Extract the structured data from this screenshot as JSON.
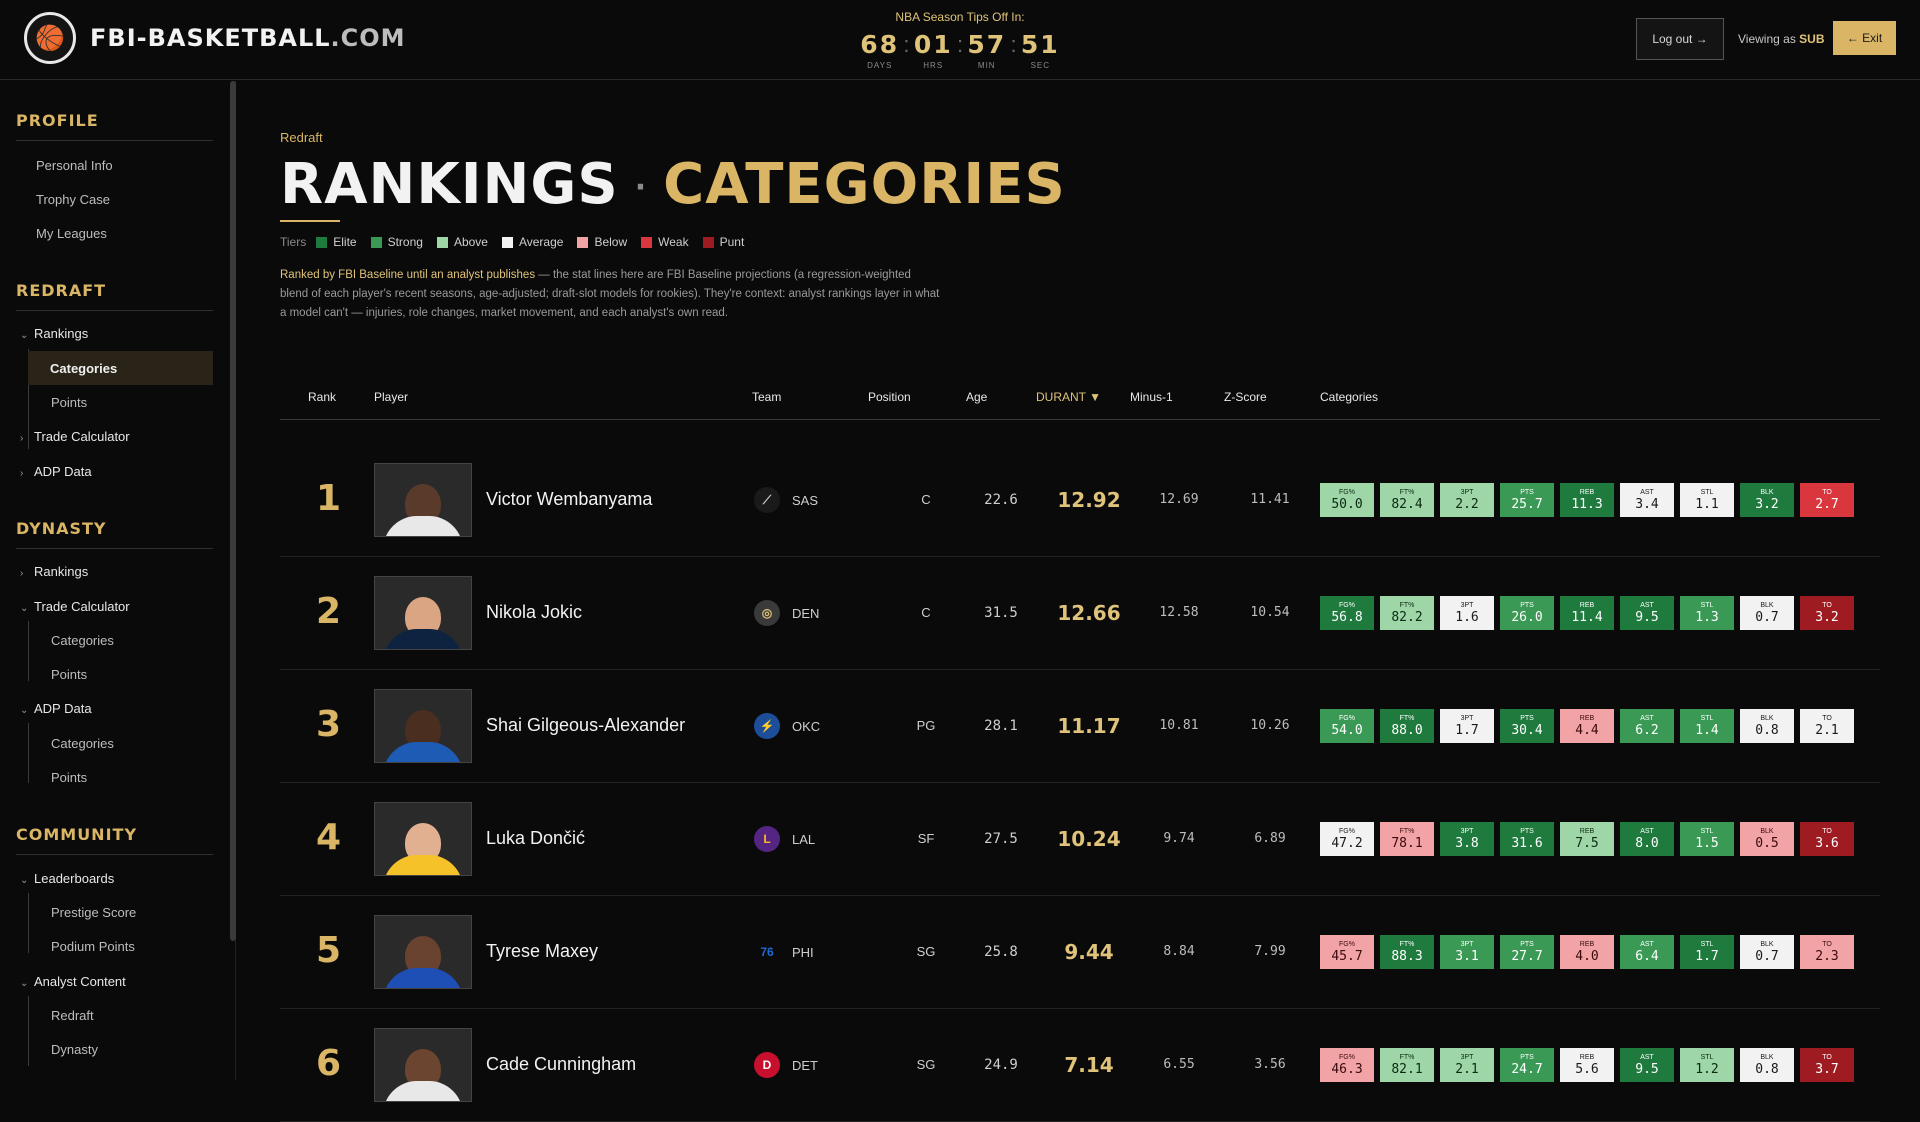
{
  "brand": {
    "name": "FBI-BASKETBALL",
    "tld": ".COM",
    "logo_icon": "basketball-logo"
  },
  "countdown": {
    "title": "NBA Season Tips Off In:",
    "units": [
      {
        "value": "68",
        "label": "DAYS"
      },
      {
        "value": "01",
        "label": "HRS"
      },
      {
        "value": "57",
        "label": "MIN"
      },
      {
        "value": "51",
        "label": "SEC"
      }
    ]
  },
  "header": {
    "logout_label": "Log out →",
    "viewing_prefix": "Viewing as",
    "viewing_role": "SUB",
    "exit_label": "← Exit"
  },
  "sidebar": {
    "profile": {
      "title": "PROFILE",
      "items": [
        "Personal Info",
        "Trophy Case",
        "My Leagues"
      ]
    },
    "redraft": {
      "title": "REDRAFT",
      "rankings": "Rankings",
      "categories": "Categories",
      "points": "Points",
      "trade": "Trade Calculator",
      "adp": "ADP Data"
    },
    "dynasty": {
      "title": "DYNASTY",
      "rankings": "Rankings",
      "trade": "Trade Calculator",
      "trade_categories": "Categories",
      "trade_points": "Points",
      "adp": "ADP Data",
      "adp_categories": "Categories",
      "adp_points": "Points"
    },
    "community": {
      "title": "COMMUNITY",
      "leaderboards": "Leaderboards",
      "prestige": "Prestige Score",
      "podium": "Podium Points",
      "analyst": "Analyst Content",
      "redraft": "Redraft",
      "dynasty": "Dynasty"
    }
  },
  "page": {
    "breadcrumb": "Redraft",
    "title_left": "RANKINGS",
    "title_sep": "·",
    "title_right": "CATEGORIES",
    "tiers_label": "Tiers",
    "tiers": [
      {
        "name": "Elite",
        "color": "#1f7a3e"
      },
      {
        "name": "Strong",
        "color": "#3a9a55"
      },
      {
        "name": "Above",
        "color": "#9fd6a8"
      },
      {
        "name": "Average",
        "color": "#f2f2f2"
      },
      {
        "name": "Below",
        "color": "#f2a3a6"
      },
      {
        "name": "Weak",
        "color": "#d9363e"
      },
      {
        "name": "Punt",
        "color": "#9e1b22"
      }
    ],
    "desc_highlight": "Ranked by FBI Baseline until an analyst publishes",
    "desc_rest": " — the stat lines here are FBI Baseline projections (a regression-weighted blend of each player's recent seasons, age-adjusted; draft-slot models for rookies). They're context: analyst rankings layer in what a model can't — injuries, role changes, market movement, and each analyst's own read."
  },
  "table": {
    "headers": {
      "rank": "Rank",
      "player": "Player",
      "team": "Team",
      "position": "Position",
      "age": "Age",
      "durant": "DURANT ▼",
      "minus1": "Minus-1",
      "zscore": "Z-Score",
      "categories": "Categories"
    },
    "cat_labels": [
      "FG%",
      "FT%",
      "3PT",
      "PTS",
      "REB",
      "AST",
      "STL",
      "BLK",
      "TO"
    ],
    "rows": [
      {
        "rank": "1",
        "name": "Victor Wembanyama",
        "team": "SAS",
        "team_icon": "spurs-icon",
        "pos": "C",
        "age": "22.6",
        "durant": "12.92",
        "minus1": "12.69",
        "z": "11.41",
        "cats": [
          [
            "50.0",
            "above"
          ],
          [
            "82.4",
            "above"
          ],
          [
            "2.2",
            "above"
          ],
          [
            "25.7",
            "strong"
          ],
          [
            "11.3",
            "elite"
          ],
          [
            "3.4",
            "average"
          ],
          [
            "1.1",
            "average"
          ],
          [
            "3.2",
            "elite"
          ],
          [
            "2.7",
            "weak"
          ]
        ]
      },
      {
        "rank": "2",
        "name": "Nikola Jokic",
        "team": "DEN",
        "team_icon": "nuggets-icon",
        "pos": "C",
        "age": "31.5",
        "durant": "12.66",
        "minus1": "12.58",
        "z": "10.54",
        "cats": [
          [
            "56.8",
            "elite"
          ],
          [
            "82.2",
            "above"
          ],
          [
            "1.6",
            "average"
          ],
          [
            "26.0",
            "strong"
          ],
          [
            "11.4",
            "elite"
          ],
          [
            "9.5",
            "elite"
          ],
          [
            "1.3",
            "strong"
          ],
          [
            "0.7",
            "average"
          ],
          [
            "3.2",
            "punt"
          ]
        ]
      },
      {
        "rank": "3",
        "name": "Shai Gilgeous-Alexander",
        "team": "OKC",
        "team_icon": "thunder-icon",
        "pos": "PG",
        "age": "28.1",
        "durant": "11.17",
        "minus1": "10.81",
        "z": "10.26",
        "cats": [
          [
            "54.0",
            "strong"
          ],
          [
            "88.0",
            "elite"
          ],
          [
            "1.7",
            "average"
          ],
          [
            "30.4",
            "elite"
          ],
          [
            "4.4",
            "below"
          ],
          [
            "6.2",
            "strong"
          ],
          [
            "1.4",
            "strong"
          ],
          [
            "0.8",
            "average"
          ],
          [
            "2.1",
            "average"
          ]
        ]
      },
      {
        "rank": "4",
        "name": "Luka Dončić",
        "team": "LAL",
        "team_icon": "lakers-icon",
        "pos": "SF",
        "age": "27.5",
        "durant": "10.24",
        "minus1": "9.74",
        "z": "6.89",
        "cats": [
          [
            "47.2",
            "average"
          ],
          [
            "78.1",
            "below"
          ],
          [
            "3.8",
            "elite"
          ],
          [
            "31.6",
            "elite"
          ],
          [
            "7.5",
            "above"
          ],
          [
            "8.0",
            "elite"
          ],
          [
            "1.5",
            "strong"
          ],
          [
            "0.5",
            "below"
          ],
          [
            "3.6",
            "punt"
          ]
        ]
      },
      {
        "rank": "5",
        "name": "Tyrese Maxey",
        "team": "PHI",
        "team_icon": "sixers-icon",
        "pos": "SG",
        "age": "25.8",
        "durant": "9.44",
        "minus1": "8.84",
        "z": "7.99",
        "cats": [
          [
            "45.7",
            "below"
          ],
          [
            "88.3",
            "elite"
          ],
          [
            "3.1",
            "strong"
          ],
          [
            "27.7",
            "strong"
          ],
          [
            "4.0",
            "below"
          ],
          [
            "6.4",
            "strong"
          ],
          [
            "1.7",
            "elite"
          ],
          [
            "0.7",
            "average"
          ],
          [
            "2.3",
            "below"
          ]
        ]
      },
      {
        "rank": "6",
        "name": "Cade Cunningham",
        "team": "DET",
        "team_icon": "pistons-icon",
        "pos": "SG",
        "age": "24.9",
        "durant": "7.14",
        "minus1": "6.55",
        "z": "3.56",
        "cats": [
          [
            "46.3",
            "below"
          ],
          [
            "82.1",
            "above"
          ],
          [
            "2.1",
            "above"
          ],
          [
            "24.7",
            "strong"
          ],
          [
            "5.6",
            "average"
          ],
          [
            "9.5",
            "elite"
          ],
          [
            "1.2",
            "above"
          ],
          [
            "0.8",
            "average"
          ],
          [
            "3.7",
            "punt"
          ]
        ]
      }
    ]
  }
}
